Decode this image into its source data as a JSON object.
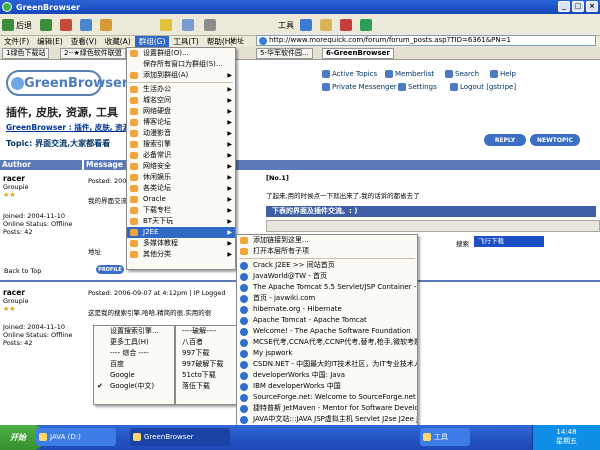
{
  "window": {
    "title": "GreenBrowser",
    "minimize": "_",
    "maximize": "□",
    "close": "×"
  },
  "toolbar": {
    "back": "后退",
    "tools_label": "工具"
  },
  "menubar": {
    "items": [
      "文件(F)",
      "编辑(E)",
      "查看(V)",
      "收藏(A)",
      "群组(G)",
      "工具(T)",
      "帮助(H)"
    ],
    "active_index": 4
  },
  "address": {
    "label": "地址",
    "url": "http://www.morequick.com/forum/forum_posts.asp?TID=6361&PN=1"
  },
  "tabs": [
    {
      "label": "1绿色下载站",
      "active": false
    },
    {
      "label": "2--★绿色软件联盟",
      "active": false
    },
    {
      "label": "5-华军软件园...",
      "active": false
    },
    {
      "label": "6-GreenBrowser",
      "active": true
    }
  ],
  "forum": {
    "logo": "GreenBrowser",
    "nav": {
      "active_topics": "Active Topics",
      "memberlist": "Memberlist",
      "search": "Search",
      "help": "Help",
      "private_messenger": "Private Messenger",
      "settings": "Settings",
      "logout": "Logout [gstripe]"
    },
    "category_title": "插件, 皮肤, 资源, 工具",
    "breadcrumb": "GreenBrowser : 插件, 皮肤, 资源",
    "topic_label": "Topic: 界面交流,大家都看看",
    "reply_button": "REPLY",
    "newtopic_button": "NEWTOPIC",
    "col_author": "Author",
    "col_message": "Message",
    "posts": [
      {
        "author": "racer",
        "rank": "Groupie",
        "joined": "Joined: 2004-11-10",
        "status": "Online Status: Offline",
        "posts": "Posts: 42",
        "posted": "Posted: 2006-09-07 at 4:...",
        "body1": "我的界面交流...",
        "body2": "了起来,用的时候点一下就出来了,我的话诉的都省去了",
        "quote": "下表的界面及插件交流。: )"
      },
      {
        "author": "racer",
        "rank": "Groupie",
        "joined": "Joined: 2004-11-10",
        "status": "Online Status: Offline",
        "posts": "Posts: 42",
        "posted": "Posted: 2006-09-07 at 4:12pm | IP Logged",
        "body1": "这是我的搜索引擎,哈哈,精简的很,实用的很"
      }
    ],
    "post_no": "[No.1]",
    "back_to_top": "Back to Top",
    "profile": "PROFILE",
    "search_label": "搜索",
    "search_value": "飞行下载"
  },
  "main_menu": {
    "items": [
      {
        "label": "设置群组(O)...",
        "submenu": false
      },
      {
        "label": "保存所有窗口为群组(S)...",
        "submenu": false
      },
      {
        "label": "添加到群组(A)",
        "submenu": true
      },
      {
        "label": "生活办公",
        "submenu": true
      },
      {
        "label": "城名空间",
        "submenu": true
      },
      {
        "label": "网络硬盘",
        "submenu": true
      },
      {
        "label": "博客论坛",
        "submenu": true
      },
      {
        "label": "动漫影音",
        "submenu": true
      },
      {
        "label": "搜索引擎",
        "submenu": true
      },
      {
        "label": "必备常识",
        "submenu": true
      },
      {
        "label": "网络安全",
        "submenu": true
      },
      {
        "label": "休闲娱乐",
        "submenu": true
      },
      {
        "label": "各类论坛",
        "submenu": true
      },
      {
        "label": "Oracle",
        "submenu": true
      },
      {
        "label": "下载专栏",
        "submenu": true
      },
      {
        "label": "BT天下玩",
        "submenu": true
      },
      {
        "label": "J2EE",
        "submenu": true
      },
      {
        "label": "多媒体教程",
        "submenu": true
      },
      {
        "label": "其他分类",
        "submenu": true
      }
    ],
    "highlight_index": 16
  },
  "j2ee_menu": {
    "actions": [
      "添加链接到这里...",
      "打开本层所有子项"
    ],
    "links": [
      "Crack J2EE >> 同站首页",
      "JavaWorld@TW - 首页",
      "The Apache Tomcat 5.5 Servlet/JSP Container - Docu...",
      "首页 - javwiki.com",
      "hibernate.org - Hibernate",
      "Apache Tomcat - Apache Tomcat",
      "Welcome! - The Apache Software Foundation",
      "MCSE代考,CCNA代考,CCNP代考,替考,枪手,微软考题,思科...",
      "My jspwork",
      "CSDN.NET - 中国最大的IT技术社区，为IT专业技术人员...",
      "developerWorks 中国: Java",
      "IBM developerWorks 中国",
      "SourceForge.net: Welcome to SourceForge.net",
      "捷特普斯 JetMaven - Mentor for Software Developmen...",
      "JAVA中文站:::JAVA JSP虚拟主机 Servlet J2se J2ee J2m..."
    ]
  },
  "search_menu": {
    "items": [
      {
        "label": "设置搜索引擎...",
        "checked": false
      },
      {
        "label": "更多工具(H)",
        "checked": false
      },
      {
        "label": "---- 综合 ----",
        "checked": false
      },
      {
        "label": "百度",
        "checked": false
      },
      {
        "label": "Google",
        "checked": false
      },
      {
        "label": "Google(中文)",
        "checked": true
      }
    ],
    "check_mark": "✔",
    "right_items": [
      "----破解----",
      "八百者",
      "997下载",
      "997破解下载",
      "51cto下载",
      "落伍下载"
    ]
  },
  "taskbar": {
    "start": "开始",
    "tasks": [
      "JAVA (D:)",
      "GreenBrowser",
      "工具"
    ],
    "tray_time": "14:48",
    "tray_day": "星期五"
  },
  "colors": {
    "accent": "#316ac5",
    "xp_blue": "#2457c5",
    "start_green": "#35902d"
  }
}
